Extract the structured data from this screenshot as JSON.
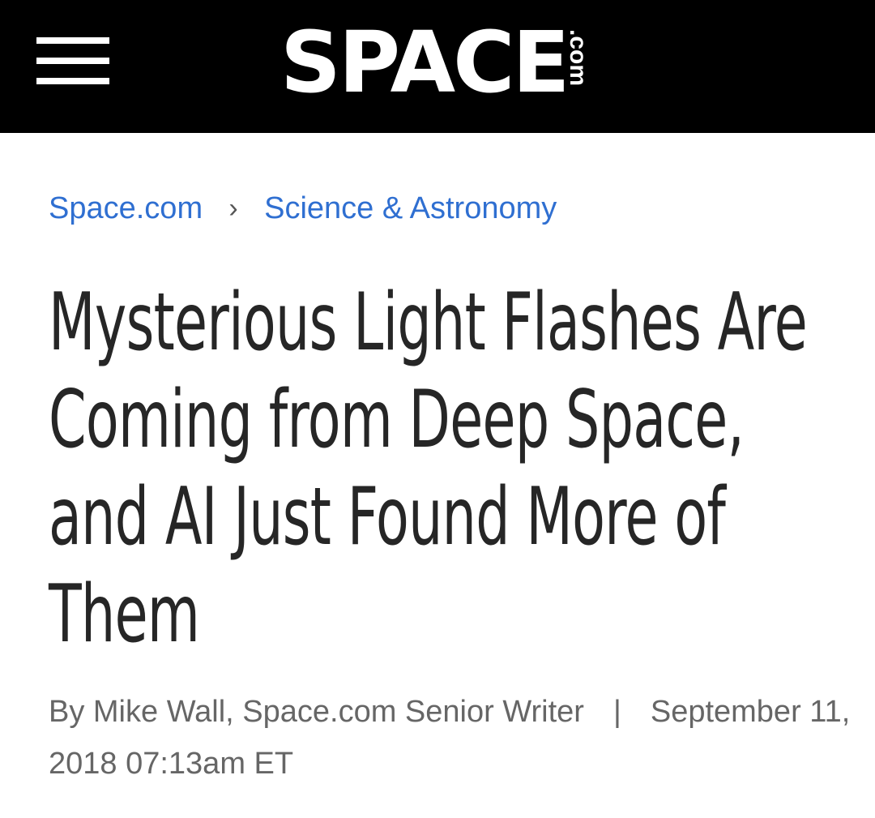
{
  "header": {
    "menu_icon": "hamburger-menu-icon",
    "logo": {
      "text": "SPACE",
      "suffix": ".com"
    }
  },
  "breadcrumb": {
    "items": [
      "Space.com",
      "Science & Astronomy"
    ],
    "separator": "›"
  },
  "article": {
    "headline": "Mysterious Light Flashes Are Coming from Deep Space, and AI Just Found More of Them",
    "author": "By Mike Wall, Space.com Senior Writer",
    "divider": "|",
    "date": "September 11, 2018 07:13am ET"
  },
  "colors": {
    "header_bg": "#000000",
    "link": "#2f6fd1",
    "headline": "#262626",
    "byline": "#666666"
  }
}
